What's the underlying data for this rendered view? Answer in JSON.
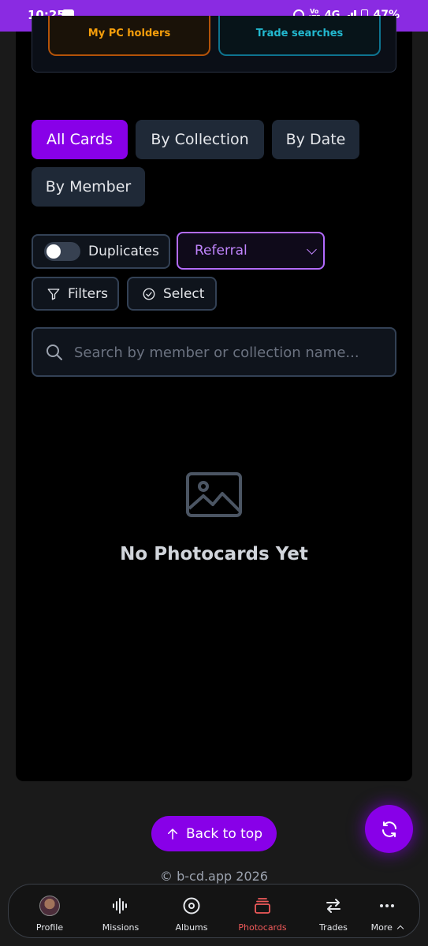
{
  "status_bar": {
    "time": "10:25",
    "network": "4G",
    "battery": "47%"
  },
  "top_buttons": {
    "pc_holders": "My PC holders",
    "trade_searches": "Trade searches"
  },
  "view_tabs": [
    {
      "label": "All Cards",
      "active": true
    },
    {
      "label": "By Collection",
      "active": false
    },
    {
      "label": "By Date",
      "active": false
    },
    {
      "label": "By Member",
      "active": false
    }
  ],
  "controls": {
    "duplicates_label": "Duplicates",
    "duplicates_on": false,
    "referral_selected": "Referral",
    "filters_label": "Filters",
    "select_label": "Select"
  },
  "search": {
    "placeholder": "Search by member or collection name..."
  },
  "empty_state": {
    "title": "No Photocards Yet"
  },
  "back_to_top": "Back to top",
  "footer": {
    "copyright": "© b-cd.app 2026"
  },
  "bottom_nav": [
    {
      "label": "Profile",
      "icon": "avatar-icon"
    },
    {
      "label": "Missions",
      "icon": "waveform-icon"
    },
    {
      "label": "Albums",
      "icon": "disc-icon"
    },
    {
      "label": "Photocards",
      "icon": "card-stack-icon",
      "active": true
    },
    {
      "label": "Trades",
      "icon": "swap-arrows-icon"
    },
    {
      "label": "More",
      "icon": "more-dots-icon"
    }
  ],
  "colors": {
    "accent": "#8800e8",
    "active_nav": "#f05a5a",
    "pc_holders": "#f59e0b",
    "trade_searches": "#22b8cf"
  }
}
